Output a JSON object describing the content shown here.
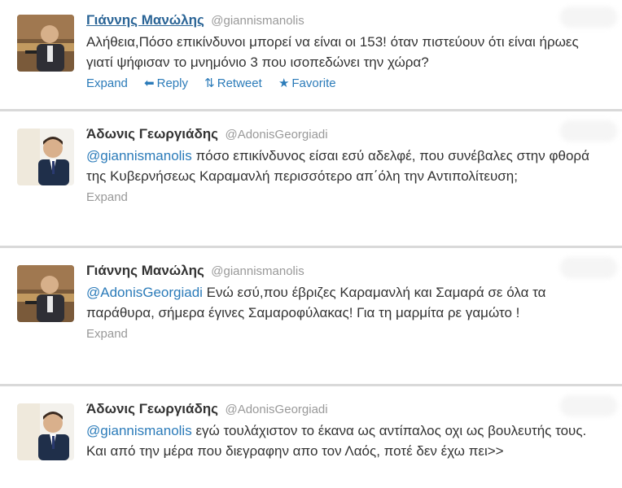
{
  "tweets": [
    {
      "fullname": "Γιάννης Μανώλης",
      "username": "@giannismanolis",
      "mention": "",
      "text": "Αλήθεια,Πόσο επικίνδυνοι μπορεί να είναι οι 153! όταν πιστεύουν ότι είναι ήρωες γιατί ψήφισαν το μνημόνιο 3 που ισοπεδώνει την χώρα?",
      "actions": {
        "expand": "Expand",
        "reply": "Reply",
        "retweet": "Retweet",
        "favorite": "Favorite"
      }
    },
    {
      "fullname": "Άδωνις Γεωργιάδης",
      "username": "@AdonisGeorgiadi",
      "mention": "@giannismanolis",
      "text": " πόσο επικίνδυνος είσαι εσύ αδελφέ, που συνέβαλες στην φθορά της Κυβερνήσεως Καραμανλή περισσότερο απ΄όλη την Αντιπολίτευση;",
      "actions": {
        "expand": "Expand"
      }
    },
    {
      "fullname": "Γιάννης Μανώλης",
      "username": "@giannismanolis",
      "mention": "@AdonisGeorgiadi",
      "text": " Ενώ εσύ,που έβριζες Καραμανλή και Σαμαρά σε όλα τα παράθυρα, σήμερα έγινες Σαμαροφύλακας! Για τη μαρμίτα ρε γαμώτο !",
      "actions": {
        "expand": "Expand"
      }
    },
    {
      "fullname": "Άδωνις Γεωργιάδης",
      "username": "@AdonisGeorgiadi",
      "mention": "@giannismanolis",
      "text": " εγώ τουλάχιστον το έκανα ως αντίπαλος οχι ως βουλευτής τους. Και από την μέρα που διεγραφην απο τον Λαός, ποτέ δεν έχω πει>>"
    }
  ],
  "icons": {
    "reply": "reply-arrow-icon",
    "retweet": "retweet-icon",
    "favorite": "star-icon"
  },
  "colors": {
    "link": "#2b7bb9",
    "muted": "#999999",
    "text": "#333333"
  }
}
